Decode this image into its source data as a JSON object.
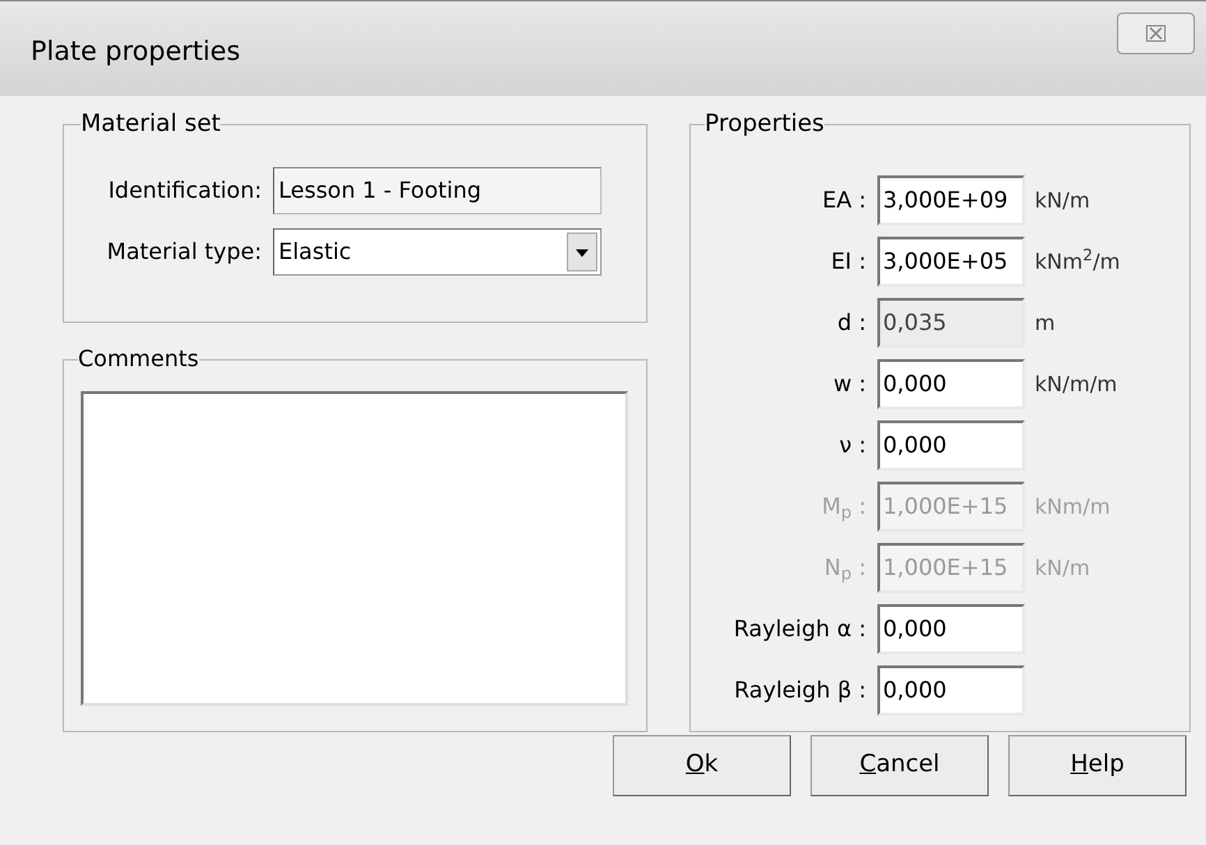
{
  "window": {
    "title": "Plate properties"
  },
  "material_set": {
    "title": "Material set",
    "identification": {
      "label": "Identification:",
      "value": "Lesson 1 - Footing"
    },
    "material_type": {
      "label": "Material type:",
      "value": "Elastic"
    }
  },
  "comments": {
    "title": "Comments"
  },
  "properties": {
    "title": "Properties",
    "rows": [
      {
        "label": "EA :",
        "value": "3,000E+09",
        "unit": "kN/m",
        "disabled": false,
        "readonly": false
      },
      {
        "label": "EI :",
        "value": "3,000E+05",
        "unit": "kNm$^{2}$/m",
        "disabled": false,
        "readonly": false
      },
      {
        "label": "d :",
        "value": "0,035",
        "unit": "m",
        "disabled": false,
        "readonly": true
      },
      {
        "label": "w :",
        "value": "0,000",
        "unit": "kN/m/m",
        "disabled": false,
        "readonly": false
      },
      {
        "label": "ν :",
        "value": "0,000",
        "disabled": false,
        "readonly": false
      },
      {
        "label": "M$_{p}$ :",
        "value": "1,000E+15",
        "unit": "kNm/m",
        "disabled": true,
        "readonly": false
      },
      {
        "label": "N$_{p}$ :",
        "value": "1,000E+15",
        "unit": "kN/m",
        "disabled": true,
        "readonly": false
      },
      {
        "label": "Rayleigh α :",
        "value": "0,000",
        "disabled": false,
        "readonly": false
      },
      {
        "label": "Rayleigh β :",
        "value": "0,000",
        "disabled": false,
        "readonly": false
      }
    ]
  },
  "buttons": [
    {
      "label": "Ok"
    },
    {
      "label": "Cancel"
    },
    {
      "label": "Help"
    }
  ]
}
